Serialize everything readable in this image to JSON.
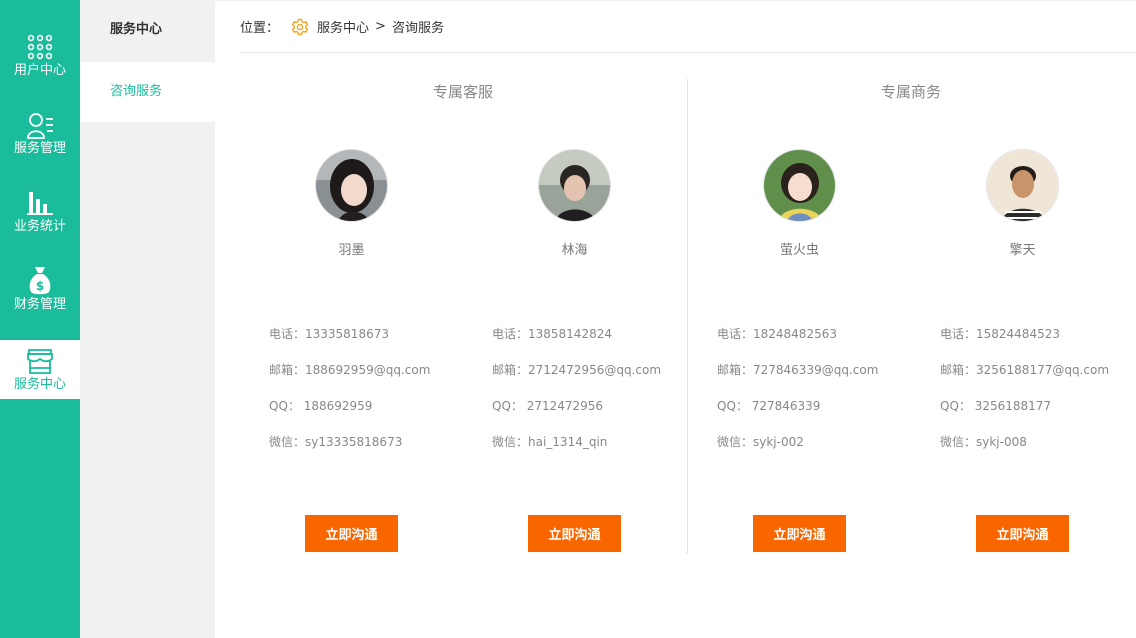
{
  "nav": {
    "items": [
      {
        "label": "用户中心",
        "icon": "grid-dots-icon"
      },
      {
        "label": "服务管理",
        "icon": "user-list-icon"
      },
      {
        "label": "业务统计",
        "icon": "bar-chart-icon"
      },
      {
        "label": "财务管理",
        "icon": "money-bag-icon"
      },
      {
        "label": "服务中心",
        "icon": "store-icon",
        "active": true
      }
    ]
  },
  "subnav": {
    "title": "服务中心",
    "items": [
      {
        "label": "咨询服务",
        "active": true
      }
    ]
  },
  "breadcrumb": {
    "prefix": "位置：",
    "icon": "gear-icon",
    "parent": "服务中心",
    "separator": ">",
    "current": "咨询服务"
  },
  "sections": [
    {
      "title": "专属客服",
      "people": [
        {
          "name": "羽墨",
          "phone": "电话：13335818673",
          "email": "邮箱：188692959@qq.com",
          "qq": "QQ： 188692959",
          "wechat": "微信：sy13335818673",
          "button": "立即沟通"
        },
        {
          "name": "林海",
          "phone": "电话：13858142824",
          "email": "邮箱：2712472956@qq.com",
          "qq": "QQ： 2712472956",
          "wechat": "微信：hai_1314_qin",
          "button": "立即沟通"
        }
      ]
    },
    {
      "title": "专属商务",
      "people": [
        {
          "name": "萤火虫",
          "phone": "电话：18248482563",
          "email": "邮箱：727846339@qq.com",
          "qq": "QQ： 727846339",
          "wechat": "微信：sykj-002",
          "button": "立即沟通"
        },
        {
          "name": "擎天",
          "phone": "电话：15824484523",
          "email": "邮箱：3256188177@qq.com",
          "qq": "QQ： 3256188177",
          "wechat": "微信：sykj-008",
          "button": "立即沟通"
        }
      ]
    }
  ],
  "colors": {
    "primary": "#1abc9c",
    "accent_button": "#f96600",
    "breadcrumb_icon": "#f5a623"
  }
}
